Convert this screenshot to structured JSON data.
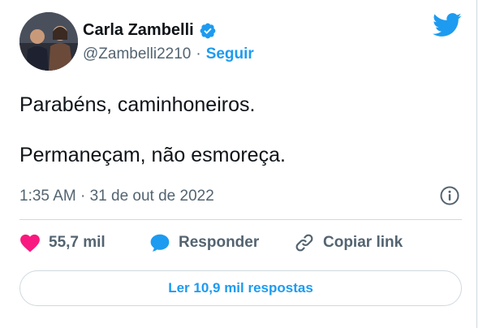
{
  "user": {
    "display_name": "Carla Zambelli",
    "handle": "@Zambelli2210",
    "separator": "·",
    "follow_label": "Seguir",
    "verified_icon": "verified-badge-icon"
  },
  "tweet": {
    "lines": [
      "Parabéns, caminhoneiros.",
      "Permaneçam, não esmoreça."
    ],
    "timestamp": "1:35 AM · 31 de out de 2022"
  },
  "actions": {
    "likes": "55,7 mil",
    "reply_label": "Responder",
    "copy_label": "Copiar link"
  },
  "read_replies_label": "Ler 10,9 mil respostas",
  "colors": {
    "accent": "#1d9bf0",
    "like": "#f91880",
    "text": "#0f1419",
    "secondary": "#536471",
    "border": "#cfd9de"
  },
  "icons": [
    "twitter-bird-icon",
    "info-icon",
    "heart-icon",
    "reply-bubble-icon",
    "link-icon"
  ]
}
